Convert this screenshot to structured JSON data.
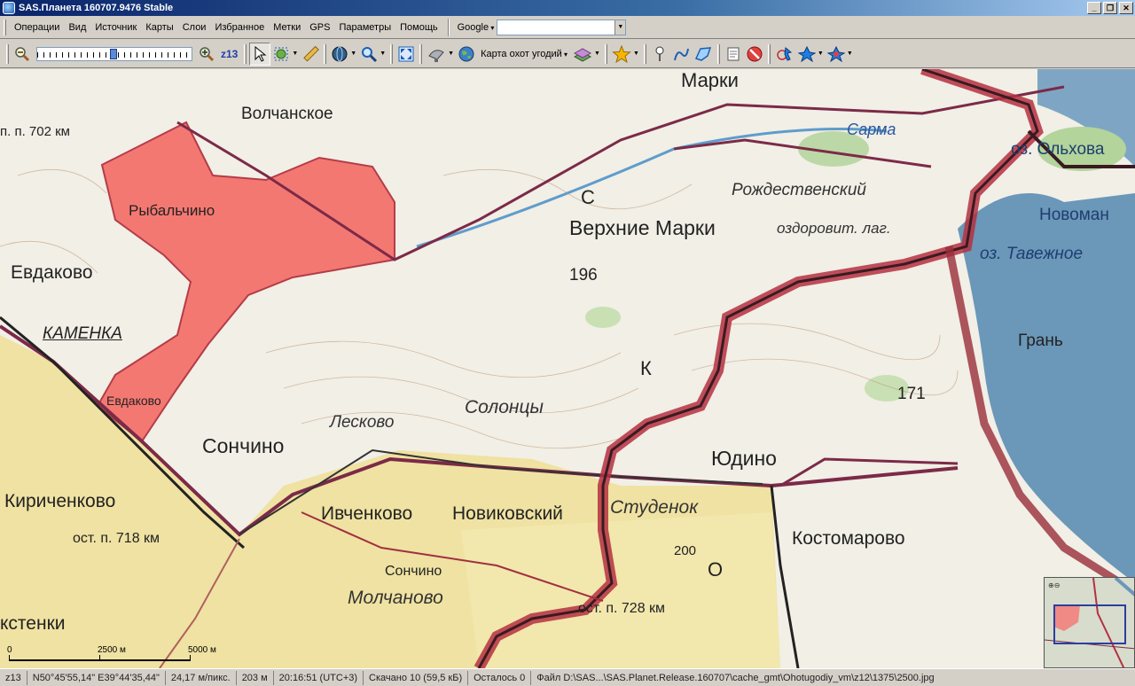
{
  "window": {
    "title": "SAS.Планета 160707.9476 Stable",
    "buttons": [
      "_",
      "❐",
      "✕"
    ]
  },
  "menu": {
    "items": [
      "Операции",
      "Вид",
      "Источник",
      "Карты",
      "Слои",
      "Избранное",
      "Метки",
      "GPS",
      "Параметры",
      "Помощь"
    ],
    "search_engine": "Google",
    "search_value": ""
  },
  "toolbar": {
    "zoom_level": "z13",
    "zoom_fraction": 0.5,
    "map_type": "Карта охот угодий"
  },
  "map": {
    "labels": {
      "marki": "Марки",
      "volchanskoe": "Волчанское",
      "ost702": "п. п. 702 км",
      "rybalchino": "Рыбальчино",
      "sarma": "Сарма",
      "olhovat": "оз. Ольхова",
      "rozhdestvensky": "Рождественский",
      "ozdorov": "оздоровит. лаг.",
      "novoman": "Новоман",
      "tavezhnoe": "оз. Тавежное",
      "verkhnie_marki": "Верхние Марки",
      "h196": "196",
      "evdakovo": "Евдаково",
      "kamenka": "КАМЕНКА",
      "gran": "Грань",
      "letter_k": "К",
      "letter_s": "С",
      "evdakovo2": "Евдаково",
      "solontsy": "Солонцы",
      "leskovo": "Лесково",
      "h171": "171",
      "sonchino": "Сончино",
      "yudino": "Юдино",
      "kirichenkovo": "Кириченково",
      "ost718": "ост. п. 718 км",
      "ivchenkovo": "Ивченково",
      "novikovsky": "Новиковский",
      "studenok": "Студенок",
      "kostomarovo": "Костомарово",
      "sonchino2": "Сончино",
      "h200": "200",
      "letter_o": "О",
      "molchanovo": "Молчаново",
      "ost728": "ост. п. 728 км",
      "kstenki": "кстенки"
    }
  },
  "scale": {
    "labels": [
      "0",
      "2500 м",
      "5000 м"
    ]
  },
  "status": {
    "zoom": "z13",
    "coords": "N50°45'55,14\" E39°44'35,44\"",
    "resolution": "24,17 м/пикс.",
    "distance": "203 м",
    "time": "20:16:51 (UTC+3)",
    "downloaded": "Скачано 10 (59,5 кБ)",
    "remaining": "Осталось 0",
    "file": "Файл D:\\SAS...\\SAS.Planet.Release.160707\\cache_gmt\\Ohotugodiy_vm\\z12\\1375\\2500.jpg"
  }
}
